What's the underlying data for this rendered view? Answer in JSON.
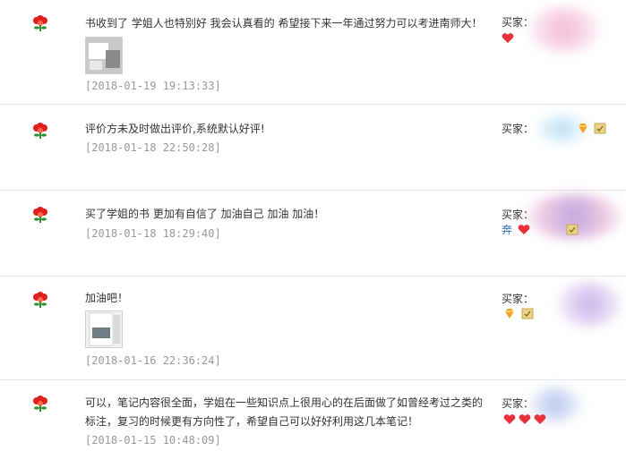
{
  "reviews": [
    {
      "comment": "书收到了 学姐人也特别好 我会认真看的 希望接下来一年通过努力可以考进南师大！",
      "date": "[2018-01-19 19:13:33]",
      "buyer_label": "买家："
    },
    {
      "comment": "评价方未及时做出评价,系统默认好评!",
      "date": "[2018-01-18 22:50:28]",
      "buyer_label": "买家："
    },
    {
      "comment": "买了学姐的书 更加有自信了 加油自己 加油 加油！",
      "date": "[2018-01-18 18:29:40]",
      "buyer_label": "买家：",
      "buyer_nick_tail": "奔"
    },
    {
      "comment": "加油吧！",
      "date": "[2018-01-16 22:36:24]",
      "buyer_label": "买家："
    },
    {
      "comment": "可以，笔记内容很全面，学姐在一些知识点上很用心的在后面做了如曾经考过之类的标注，复习的时候更有方向性了，希望自己可以好好利用这几本笔记！",
      "date": "[2018-01-15 10:48:09]",
      "buyer_label": "买家："
    }
  ],
  "icons": {
    "flower": "red-flower-icon",
    "heart": "red-heart-icon",
    "diamond": "diamond-icon",
    "verified": "verified-badge-icon"
  },
  "colors": {
    "date": "#999999",
    "divider": "#e6e6e6",
    "flower": "#e0201c",
    "heart": "#e8313a",
    "diamond": "#f3a21b"
  }
}
